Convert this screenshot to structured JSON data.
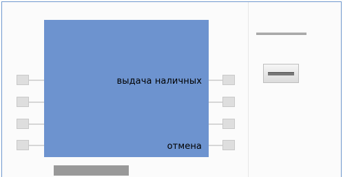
{
  "screen": {
    "label_withdraw": "выдача наличных",
    "label_cancel": "отмена"
  },
  "keys": {
    "left": [
      "",
      "",
      "",
      ""
    ],
    "right": [
      "",
      "",
      "",
      ""
    ]
  }
}
